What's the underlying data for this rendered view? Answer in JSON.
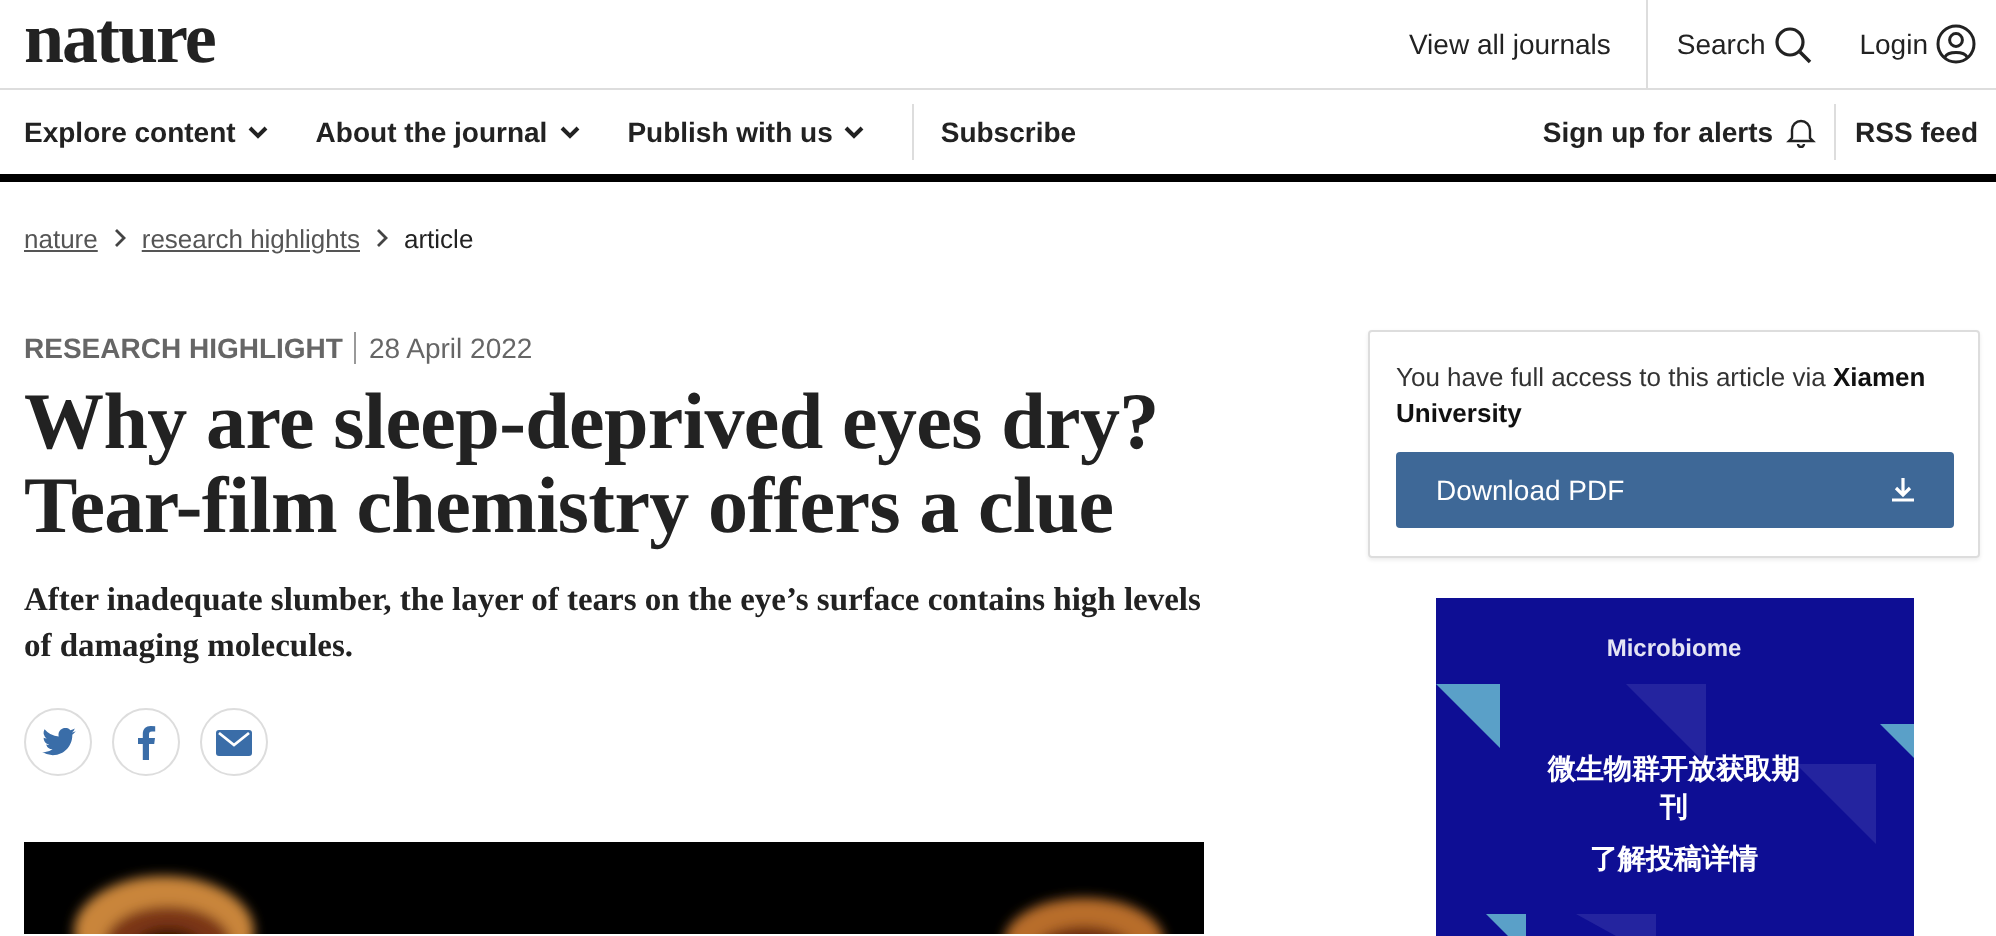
{
  "header": {
    "logo": "nature",
    "links": [
      {
        "label": "View all journals",
        "kind": "text"
      },
      {
        "label": "Search",
        "kind": "search"
      },
      {
        "label": "Login",
        "kind": "login"
      }
    ]
  },
  "nav": {
    "left": [
      {
        "label": "Explore content",
        "dropdown": true
      },
      {
        "label": "About the journal",
        "dropdown": true
      },
      {
        "label": "Publish with us",
        "dropdown": true
      },
      {
        "label": "Subscribe",
        "dropdown": false
      }
    ],
    "right": [
      {
        "label": "Sign up for alerts",
        "kind": "alerts"
      },
      {
        "label": "RSS feed",
        "kind": "text"
      }
    ]
  },
  "breadcrumb": [
    {
      "label": "nature",
      "link": true
    },
    {
      "label": "research highlights",
      "link": true
    },
    {
      "label": "article",
      "link": false
    }
  ],
  "article": {
    "type": "RESEARCH HIGHLIGHT",
    "date": "28 April 2022",
    "title": "Why are sleep-deprived eyes dry? Tear-film chemistry offers a clue",
    "standfirst": "After inadequate slumber, the layer of tears on the eye’s surface contains high levels of damaging molecules.",
    "share": [
      {
        "kind": "twitter"
      },
      {
        "kind": "facebook"
      },
      {
        "kind": "email"
      }
    ]
  },
  "access": {
    "text": "You have full access to this article via **Xiamen University**",
    "button": "Download PDF"
  },
  "ad": {
    "brand": "Microbiome",
    "headline": "微生物群开放获取期刊",
    "cta": "了解投稿详情"
  }
}
